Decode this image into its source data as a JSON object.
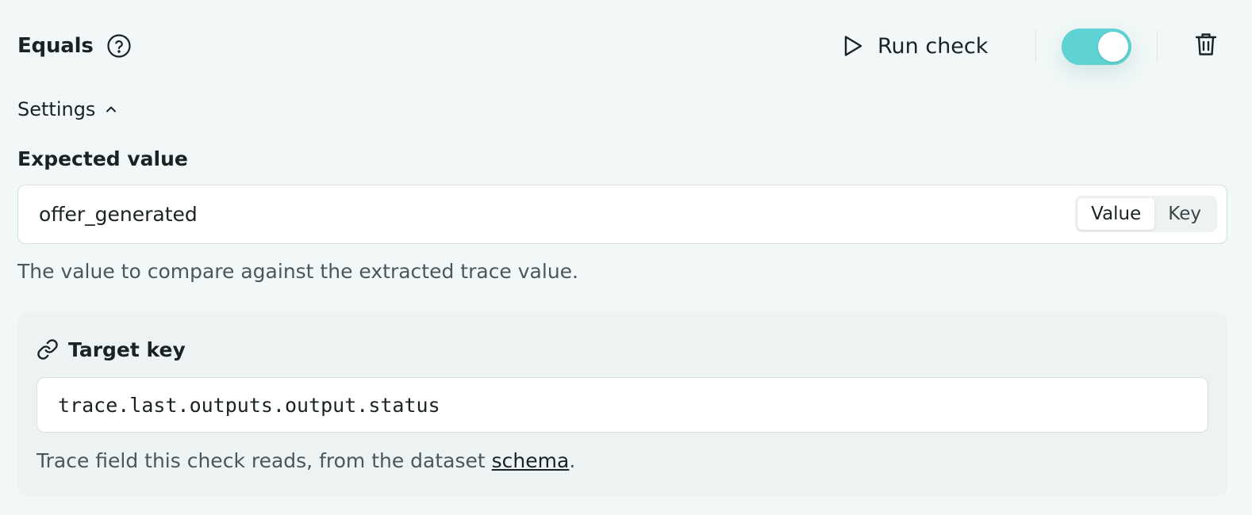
{
  "header": {
    "title": "Equals",
    "run_label": "Run check",
    "toggle_on": true
  },
  "settings": {
    "label": "Settings"
  },
  "expected": {
    "label": "Expected value",
    "value": "offer_generated",
    "segments": [
      {
        "label": "Value",
        "active": true
      },
      {
        "label": "Key",
        "active": false
      }
    ],
    "help": "The value to compare against the extracted trace value."
  },
  "target": {
    "label": "Target key",
    "value": "trace.last.outputs.output.status",
    "help_prefix": "Trace field this check reads, from the dataset ",
    "help_link": "schema",
    "help_suffix": "."
  },
  "colors": {
    "accent": "#5fd3d3",
    "background": "#f1f8f7",
    "card": "#edf3f2"
  },
  "icons": [
    "help-circle-icon",
    "play-icon",
    "trash-icon",
    "chevron-up-icon",
    "link-icon"
  ]
}
